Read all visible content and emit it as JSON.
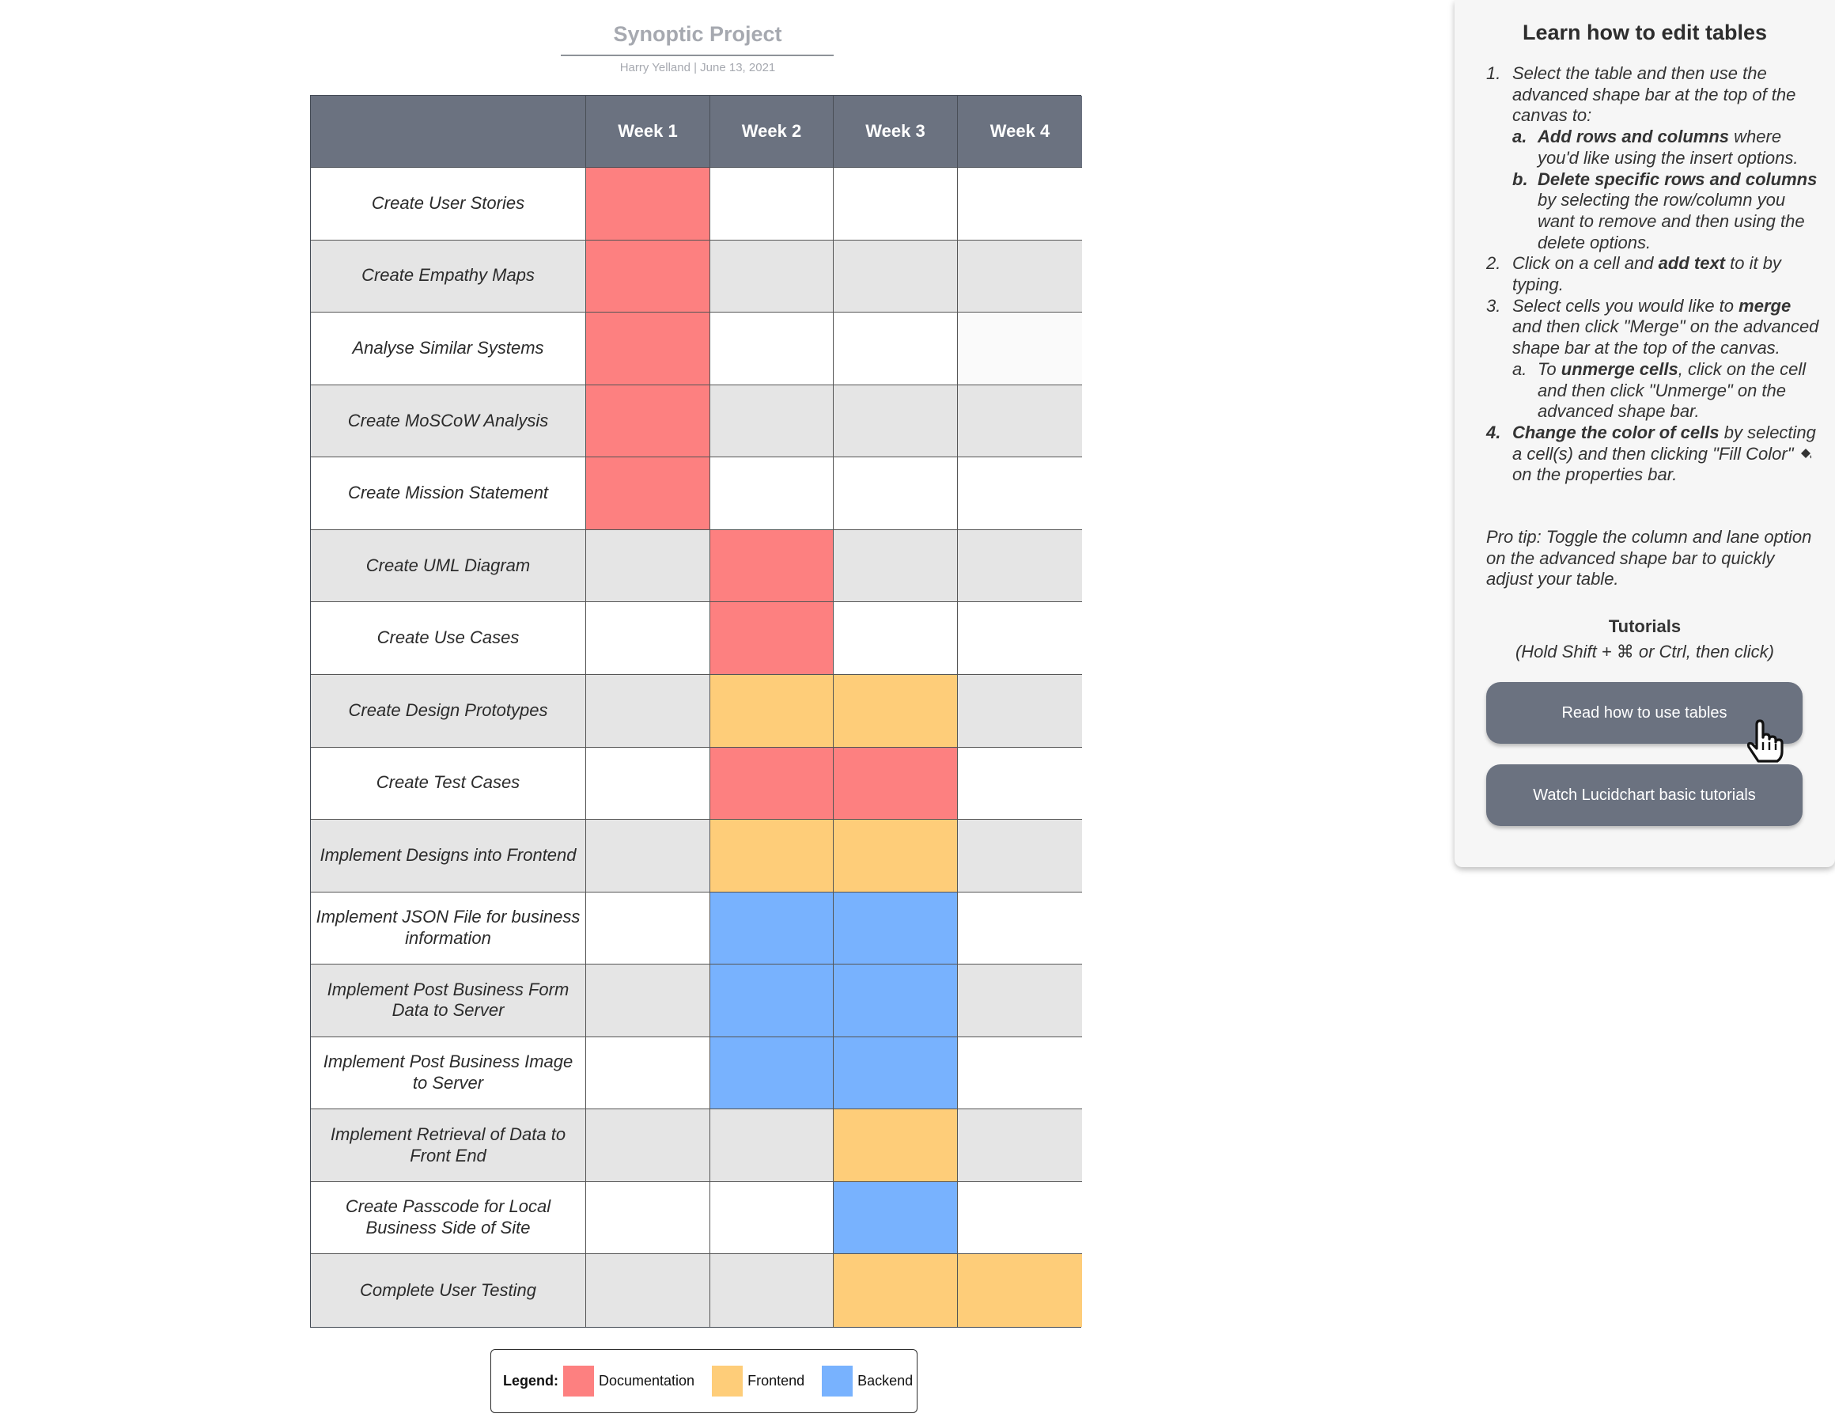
{
  "doc": {
    "title": "Synoptic Project",
    "meta": "Harry Yelland  |  June 13, 2021"
  },
  "colors": {
    "documentation": "#fd8080",
    "frontend": "#fecd79",
    "backend": "#78b2fe",
    "header": "#6b7280",
    "row_shaded": "#e5e5e5",
    "row_plain": "#ffffff",
    "cell_faint": "#fafafa"
  },
  "table": {
    "corner": "",
    "weeks": [
      "Week 1",
      "Week 2",
      "Week 3",
      "Week 4"
    ],
    "rows": [
      {
        "task": "Create User Stories",
        "cells": [
          "documentation",
          "",
          "",
          ""
        ]
      },
      {
        "task": "Create Empathy Maps",
        "cells": [
          "documentation",
          "",
          "",
          ""
        ]
      },
      {
        "task": "Analyse Similar Systems",
        "cells": [
          "documentation",
          "",
          "",
          "faint"
        ]
      },
      {
        "task": "Create MoSCoW Analysis",
        "cells": [
          "documentation",
          "",
          "",
          ""
        ]
      },
      {
        "task": "Create Mission Statement",
        "cells": [
          "documentation",
          "",
          "",
          ""
        ]
      },
      {
        "task": "Create UML Diagram",
        "cells": [
          "",
          "documentation",
          "",
          ""
        ]
      },
      {
        "task": "Create Use Cases",
        "cells": [
          "",
          "documentation",
          "",
          ""
        ]
      },
      {
        "task": "Create Design Prototypes",
        "cells": [
          "",
          "frontend",
          "frontend",
          ""
        ]
      },
      {
        "task": "Create Test Cases",
        "cells": [
          "",
          "documentation",
          "documentation",
          ""
        ]
      },
      {
        "task": "Implement Designs into Frontend",
        "cells": [
          "",
          "frontend",
          "frontend",
          ""
        ]
      },
      {
        "task": "Implement JSON File for business information",
        "cells": [
          "",
          "backend",
          "backend",
          ""
        ]
      },
      {
        "task": "Implement Post Business Form Data to Server",
        "cells": [
          "",
          "backend",
          "backend",
          ""
        ]
      },
      {
        "task": "Implement Post Business Image to Server",
        "cells": [
          "",
          "backend",
          "backend",
          ""
        ]
      },
      {
        "task": "Implement Retrieval of Data to Front End",
        "cells": [
          "",
          "",
          "frontend",
          ""
        ]
      },
      {
        "task": "Create Passcode for Local Business Side of Site",
        "cells": [
          "",
          "",
          "backend",
          ""
        ]
      },
      {
        "task": "Complete User Testing",
        "cells": [
          "",
          "",
          "frontend",
          "frontend"
        ]
      }
    ]
  },
  "legend": {
    "title": "Legend:",
    "items": [
      {
        "label": "Documentation",
        "color": "#fd8080"
      },
      {
        "label": "Frontend",
        "color": "#fecd79"
      },
      {
        "label": "Backend",
        "color": "#78b2fe"
      }
    ]
  },
  "help": {
    "title": "Learn how to edit tables",
    "step1": {
      "num": "1.",
      "text": "Select the table and then use the advanced shape bar at the top of the canvas to:",
      "a_num": "a.",
      "a_bold": "Add rows and columns",
      "a_rest": " where you'd like using the insert options.",
      "b_num": "b.",
      "b_bold": "Delete specific rows and columns",
      "b_rest": " by selecting the row/column you want to remove and then using the delete options."
    },
    "step2": {
      "num": "2.",
      "pre": "Click on a cell and ",
      "bold": "add text",
      "post": " to it by typing."
    },
    "step3": {
      "num": "3.",
      "pre": "Select cells you would like to ",
      "bold": "merge",
      "post": " and then click \"Merge\" on the advanced shape bar at the top of the canvas.",
      "a_num": "a.",
      "a_pre": "To ",
      "a_bold": "unmerge cells",
      "a_post": ", click on the cell and then click \"Unmerge\" on the advanced shape bar."
    },
    "step4": {
      "num": "4.",
      "bold": "Change the color of cells",
      "post1": " by selecting a cell(s) and then clicking \"Fill Color\" ",
      "icon": "paint-bucket-icon",
      "post2": " on the properties bar."
    },
    "pro_tip": "Pro tip: Toggle the column and lane option on the advanced shape bar to quickly adjust your table.",
    "tutorials_title": "Tutorials",
    "tutorials_hint": "(Hold Shift + ⌘ or Ctrl, then click)",
    "read_button": "Read how to use tables",
    "watch_button": "Watch Lucidchart basic tutorials"
  }
}
